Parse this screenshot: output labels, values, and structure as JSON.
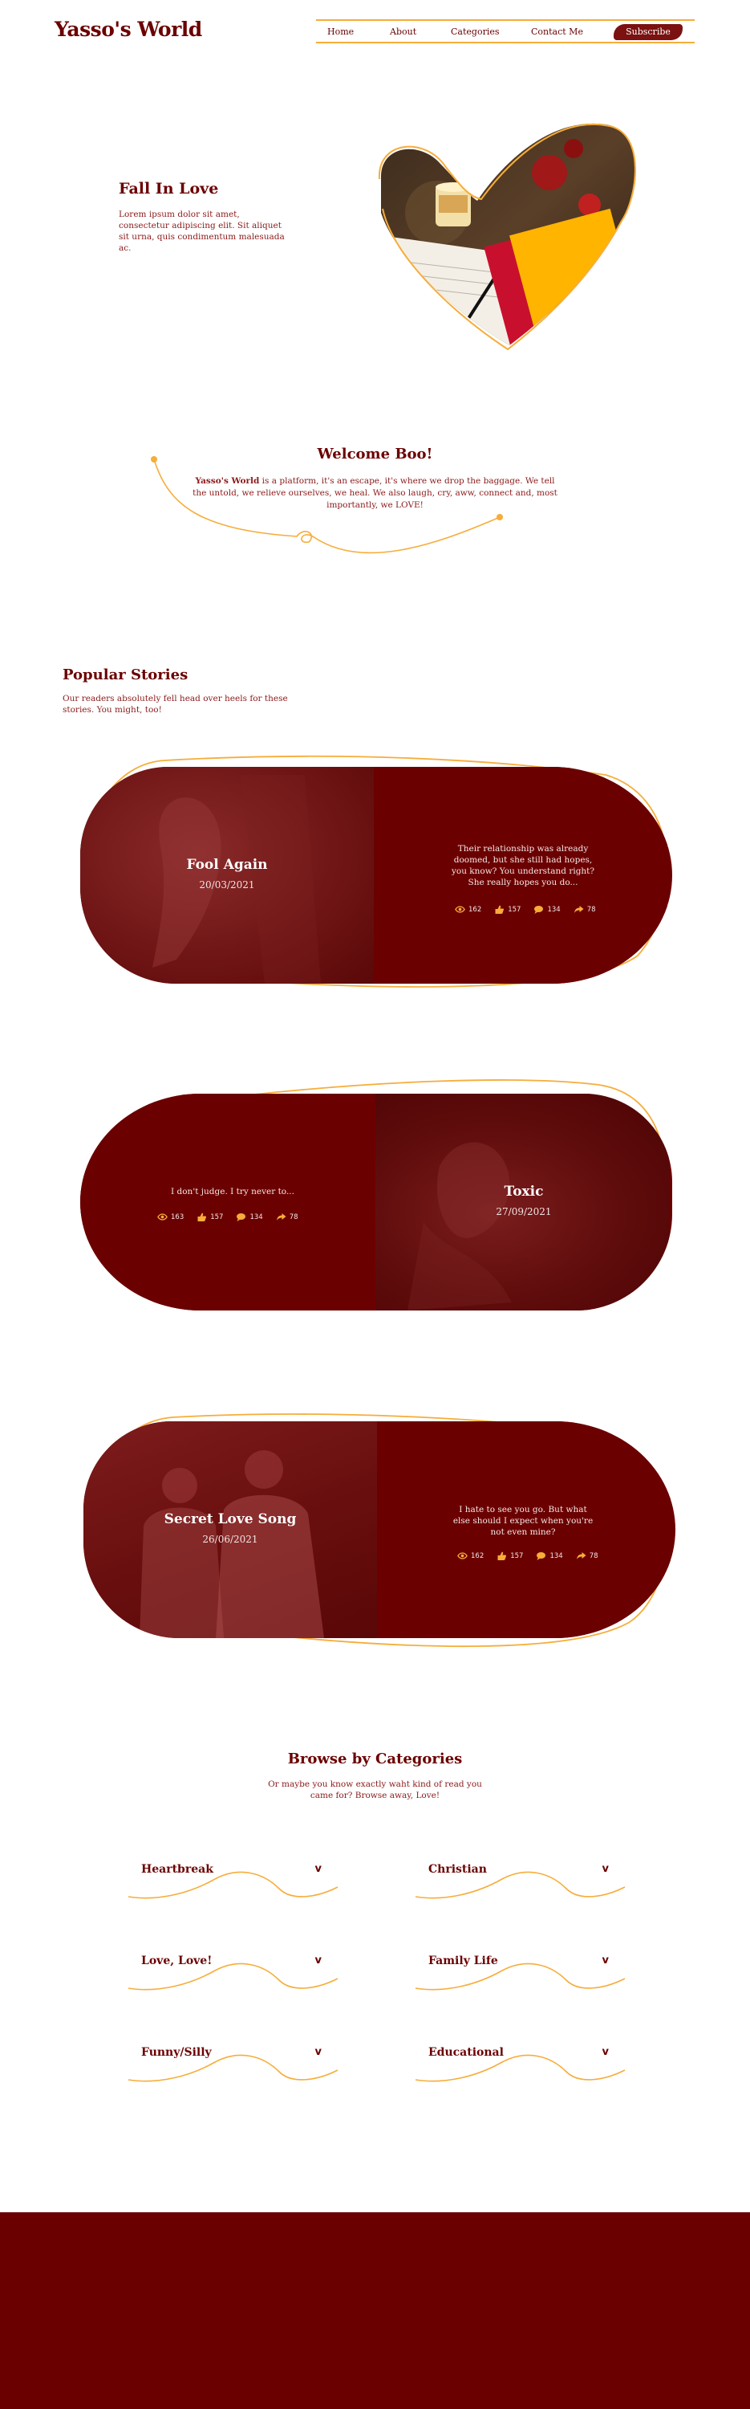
{
  "header": {
    "logo": "Yasso's World",
    "nav": [
      {
        "label": "Home"
      },
      {
        "label": "About"
      },
      {
        "label": "Categories"
      },
      {
        "label": "Contact Me"
      }
    ],
    "subscribe_label": "Subscribe"
  },
  "hero": {
    "title": "Fall In Love",
    "text": "Lorem ipsum dolor sit amet, consectetur adipiscing elit. Sit aliquet sit urna, quis condimentum malesuada ac."
  },
  "welcome": {
    "title": "Welcome Boo!",
    "brand": "Yasso's World",
    "text": " is a platform, it's an escape, it's where we drop the baggage. We tell the untold, we relieve ourselves, we heal. We also laugh, cry, aww, connect and, most importantly, we LOVE!"
  },
  "popular": {
    "title": "Popular Stories",
    "text": "Our readers absolutely fell head over heels for these stories. You might, too!",
    "stories": [
      {
        "title": "Fool Again",
        "date": "20/03/2021",
        "excerpt": "Their relationship was already doomed, but she still had hopes, you know? You understand right? She really hopes you do...",
        "views": "162",
        "likes": "157",
        "comments": "134",
        "shares": "78"
      },
      {
        "title": "Toxic",
        "date": "27/09/2021",
        "excerpt": "I don't judge. I try never to...",
        "views": "163",
        "likes": "157",
        "comments": "134",
        "shares": "78"
      },
      {
        "title": "Secret Love Song",
        "date": "26/06/2021",
        "excerpt": "I hate to see you go. But what else should I expect when you're not even mine?",
        "views": "162",
        "likes": "157",
        "comments": "134",
        "shares": "78"
      }
    ]
  },
  "categories": {
    "title": "Browse by Categories",
    "text": "Or maybe you know exactly waht kind of read you came for? Browse away, Love!",
    "items": [
      {
        "label": "Heartbreak"
      },
      {
        "label": "Christian"
      },
      {
        "label": "Love, Love!"
      },
      {
        "label": "Family Life"
      },
      {
        "label": "Funny/Silly"
      },
      {
        "label": "Educational"
      }
    ]
  },
  "colors": {
    "brand": "#6b0000",
    "accent": "#f6ad3a",
    "button": "#7b1111"
  },
  "icons": [
    "eye-icon",
    "thumbs-up-icon",
    "comment-icon",
    "share-icon",
    "chevron-down-icon"
  ]
}
